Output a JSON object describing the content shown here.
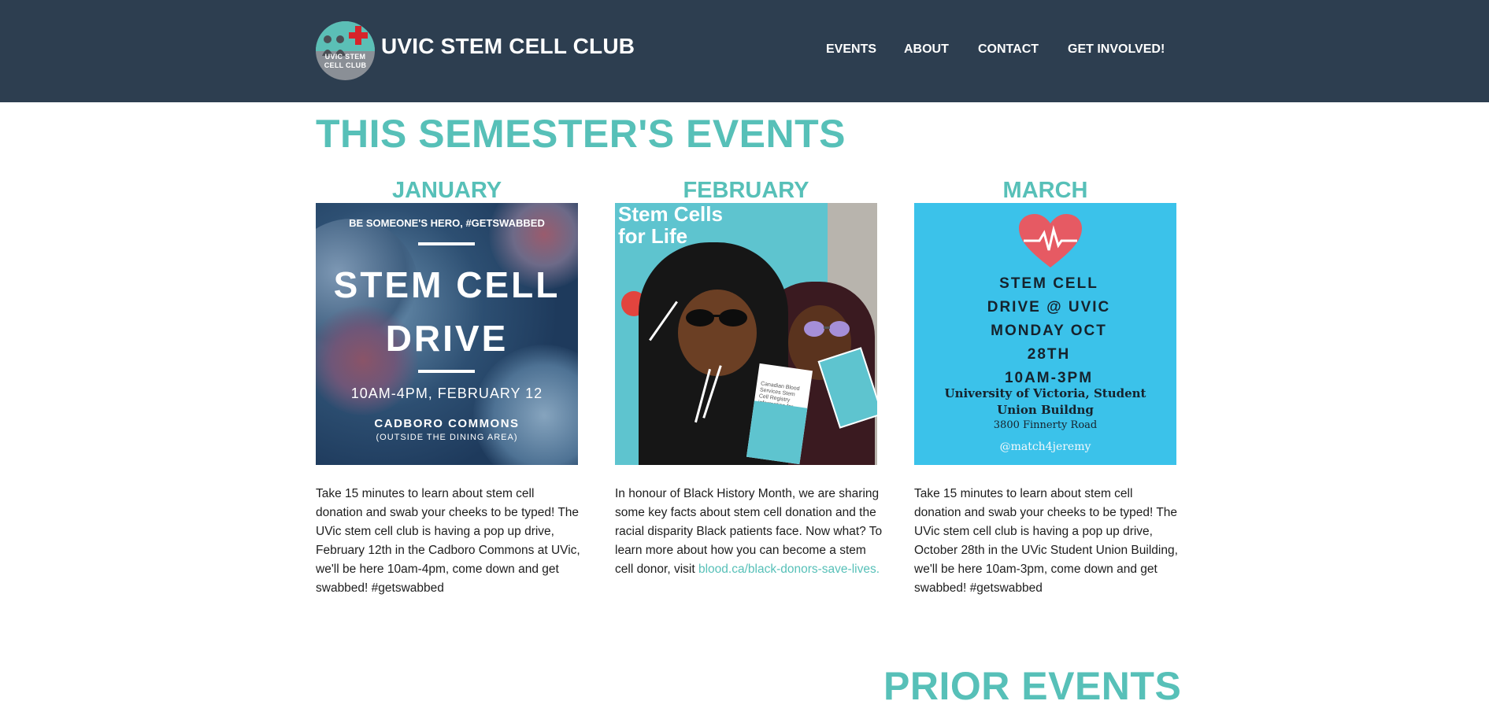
{
  "header": {
    "logo_text": "UVIC STEM CELL CLUB",
    "site_title": "UVIC STEM CELL CLUB",
    "nav": [
      "EVENTS",
      "ABOUT",
      "CONTACT",
      "GET INVOLVED!"
    ]
  },
  "main": {
    "section_title": "THIS SEMESTER'S EVENTS",
    "events": [
      {
        "month": "JANUARY",
        "poster": {
          "tagline": "BE SOMEONE'S HERO, #GETSWABBED",
          "headline_1": "STEM CELL",
          "headline_2": "DRIVE",
          "time": "10AM-4PM, FEBRUARY 12",
          "location": "CADBORO COMMONS",
          "location_note": "(OUTSIDE THE DINING AREA)"
        },
        "description": "Take 15 minutes to learn about stem cell donation and swab your cheeks to be typed! The UVic stem cell club is having a pop up drive, February 12th in the Cadboro Commons at UVic, we'll be here 10am-4pm, come down and get swabbed! #getswabbed"
      },
      {
        "month": "FEBRUARY",
        "poster": {
          "banner_text_1": "Stem Cells",
          "banner_text_2": "for Life",
          "card_text": "Canadian Blood Services Stem Cell Registry information for new registrants"
        },
        "description": "In honour of Black History Month, we are sharing some key facts about stem cell donation and the racial disparity Black patients face. Now what? To learn more about how you can become a stem cell donor, visit",
        "link": "blood.ca/black-donors-save-lives."
      },
      {
        "month": "MARCH",
        "poster": {
          "line_1": "STEM CELL",
          "line_2": "DRIVE @ UVIC",
          "line_3": "MONDAY OCT",
          "line_4": "28TH",
          "line_5": "10AM-3PM",
          "venue": "University of Victoria, Student Union Buildng",
          "address": "3800 Finnerty Road",
          "handle": "@match4jeremy"
        },
        "description": "Take 15 minutes to learn about stem cell donation and swab your cheeks to be typed! The UVic stem cell club is having a pop up drive, October 28th in the UVic Student Union Building, we'll be here 10am-3pm, come down and get swabbed! #getswabbed"
      }
    ],
    "prior_title": "PRIOR EVENTS"
  },
  "colors": {
    "header_bg": "#2d3e50",
    "accent": "#57c0b8",
    "text": "#1d1d1d"
  },
  "icons": [
    "logo-icon",
    "heart-icon"
  ]
}
